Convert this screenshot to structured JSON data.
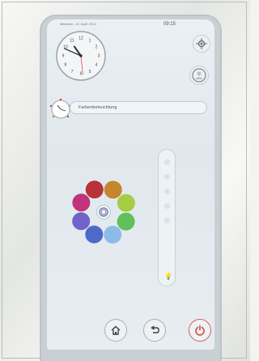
{
  "status_bar": {
    "date": "Mittwoch, 10. April 2013",
    "time": "09:15"
  },
  "clock": {
    "hour": 10,
    "minute": 49,
    "second": 29
  },
  "lighting": {
    "label": "Farbenbeleuchtung"
  },
  "color_palette": [
    {
      "name": "dark-red",
      "color": "#b83238"
    },
    {
      "name": "amber",
      "color": "#c5862d"
    },
    {
      "name": "lime",
      "color": "#a6cc44"
    },
    {
      "name": "green",
      "color": "#61c05b"
    },
    {
      "name": "light-blue",
      "color": "#8cbbe8"
    },
    {
      "name": "blue",
      "color": "#4f69c8"
    },
    {
      "name": "violet-blue",
      "color": "#6f62c8"
    },
    {
      "name": "magenta",
      "color": "#c0347b"
    }
  ],
  "brightness_steps": 5,
  "navigation": {
    "home_icon": "home-icon",
    "back_icon": "back-arrow-icon",
    "power_icon": "power-icon"
  }
}
